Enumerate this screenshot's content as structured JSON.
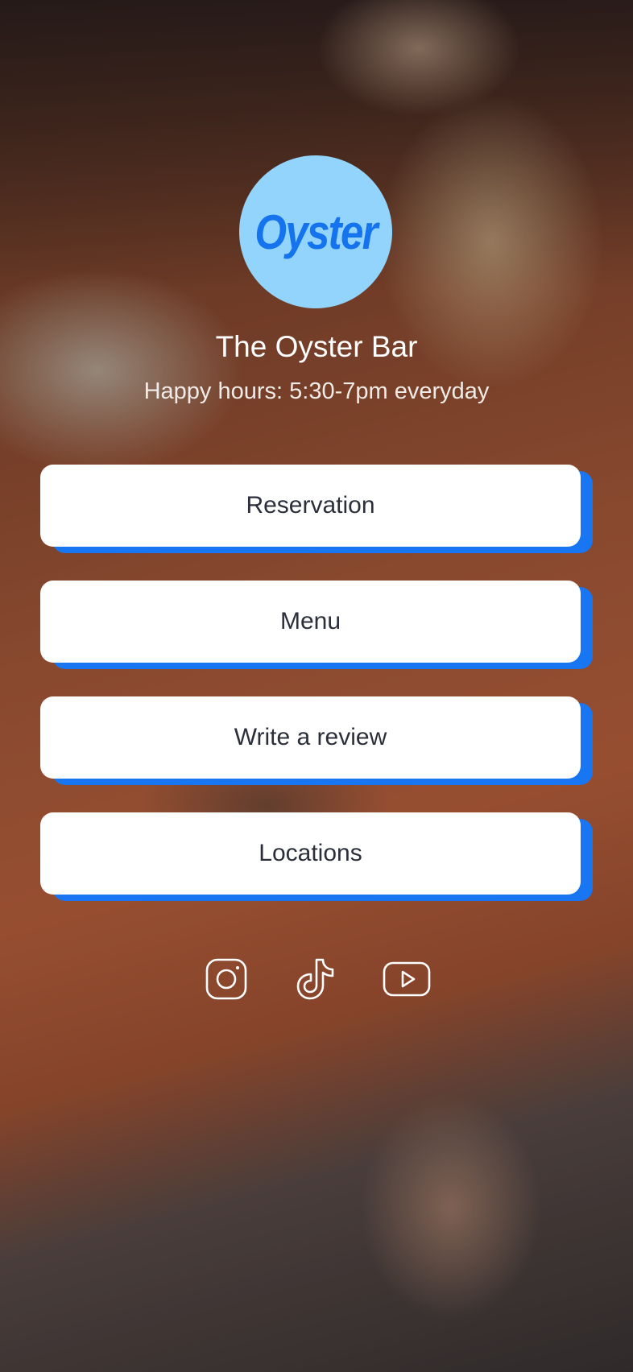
{
  "brand": {
    "logo_text": "Oyster",
    "logo_bg": "#93d4fd",
    "logo_fg": "#1673ee"
  },
  "profile": {
    "title": "The Oyster Bar",
    "subtitle": "Happy hours: 5:30-7pm everyday"
  },
  "links": [
    {
      "label": "Reservation"
    },
    {
      "label": "Menu"
    },
    {
      "label": "Write a review"
    },
    {
      "label": "Locations"
    }
  ],
  "socials": [
    {
      "icon": "instagram-icon"
    },
    {
      "icon": "tiktok-icon"
    },
    {
      "icon": "youtube-icon"
    }
  ],
  "colors": {
    "button_bg": "#ffffff",
    "button_shadow": "#1876f2",
    "button_text": "#2b2f3a",
    "title_text": "#ffffff"
  }
}
